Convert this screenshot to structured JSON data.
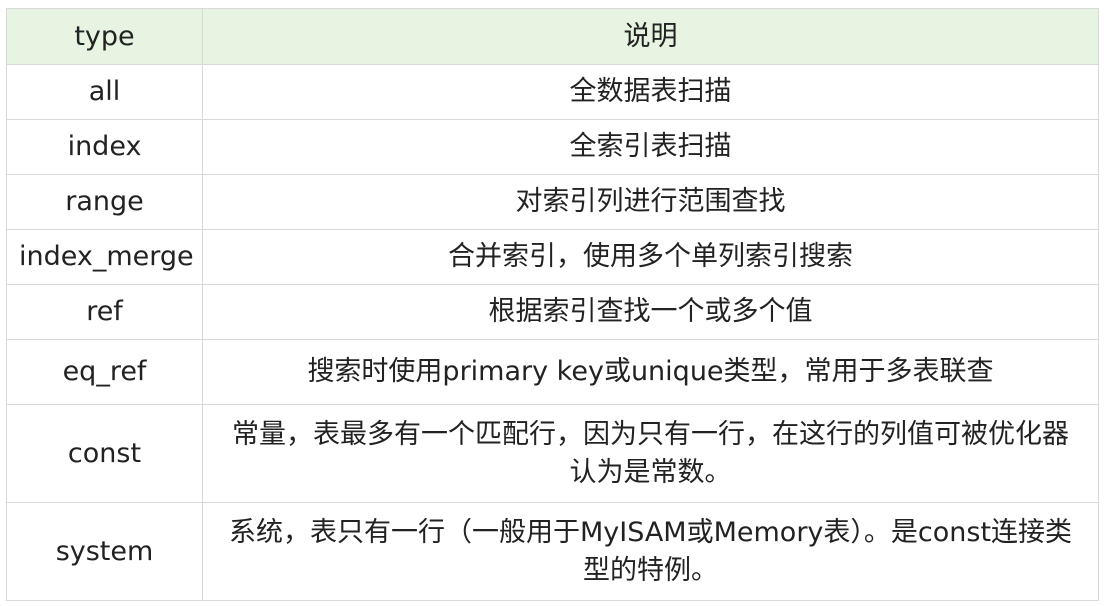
{
  "table": {
    "headers": [
      "type",
      "说明"
    ],
    "rows": [
      {
        "type": "all",
        "desc": "全数据表扫描"
      },
      {
        "type": "index",
        "desc": "全索引表扫描"
      },
      {
        "type": "range",
        "desc": "对索引列进行范围查找"
      },
      {
        "type": "index_merge",
        "desc": "合并索引，使用多个单列索引搜索"
      },
      {
        "type": "ref",
        "desc": "根据索引查找一个或多个值"
      },
      {
        "type": "eq_ref",
        "desc": "搜索时使用primary key或unique类型，常用于多表联查"
      },
      {
        "type": "const",
        "desc": "常量，表最多有一个匹配行，因为只有一行，在这行的列值可被优化器认为是常数。"
      },
      {
        "type": "system",
        "desc": "系统，表只有一行（一般用于MyISAM或Memory表）。是const连接类型的特例。"
      }
    ]
  },
  "colors": {
    "header_bg": "#e6f4e1",
    "border": "#d9d9d9",
    "text": "#222222"
  }
}
